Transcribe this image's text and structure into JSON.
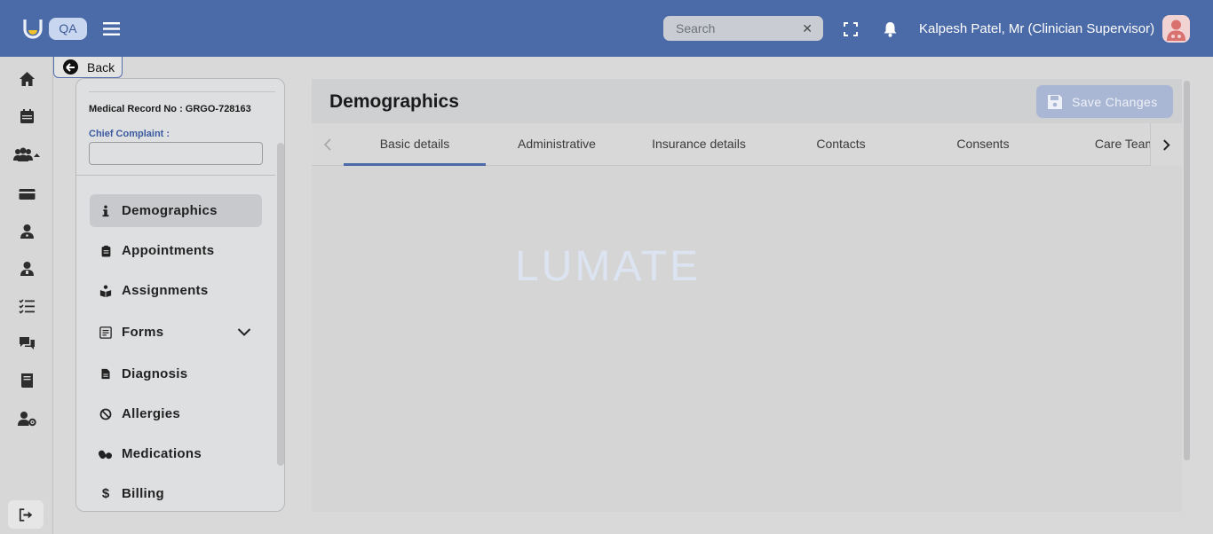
{
  "header": {
    "env_badge": "QA",
    "search": {
      "placeholder": "Search"
    },
    "user_name": "Kalpesh Patel, Mr (Clinician Supervisor)"
  },
  "rail": {
    "icons": [
      "home-icon",
      "calendar-icon",
      "patients-icon",
      "billing-card-icon",
      "clinician-icon",
      "staff-icon",
      "task-list-icon",
      "chat-icon",
      "book-icon",
      "user-settings-icon"
    ],
    "logout_icon": "logout-icon"
  },
  "back": {
    "label": "Back"
  },
  "patient": {
    "mrn_label": "Medical Record No : GRGO-728163",
    "chief_complaint_label": "Chief Complaint :",
    "chief_complaint_value": ""
  },
  "nav": {
    "items": [
      {
        "label": "Demographics",
        "icon": "info-icon",
        "active": true
      },
      {
        "label": "Appointments",
        "icon": "clipboard-icon"
      },
      {
        "label": "Assignments",
        "icon": "assignments-icon"
      },
      {
        "label": "Forms",
        "icon": "form-icon",
        "expandable": true
      },
      {
        "label": "Diagnosis",
        "icon": "document-icon"
      },
      {
        "label": "Allergies",
        "icon": "ban-icon"
      },
      {
        "label": "Medications",
        "icon": "pills-icon"
      },
      {
        "label": "Billing",
        "icon": "dollar-icon"
      }
    ]
  },
  "main": {
    "title": "Demographics",
    "save_label": "Save Changes",
    "tabs": [
      "Basic details",
      "Administrative",
      "Insurance details",
      "Contacts",
      "Consents",
      "Care Team"
    ],
    "active_tab": "Basic details",
    "watermark": "LUMATE"
  },
  "colors": {
    "topbar": "#4b6aa8",
    "accent": "#4b6aa8",
    "save_button": "#a9b7d5",
    "active_nav": "#c8c9cc"
  }
}
